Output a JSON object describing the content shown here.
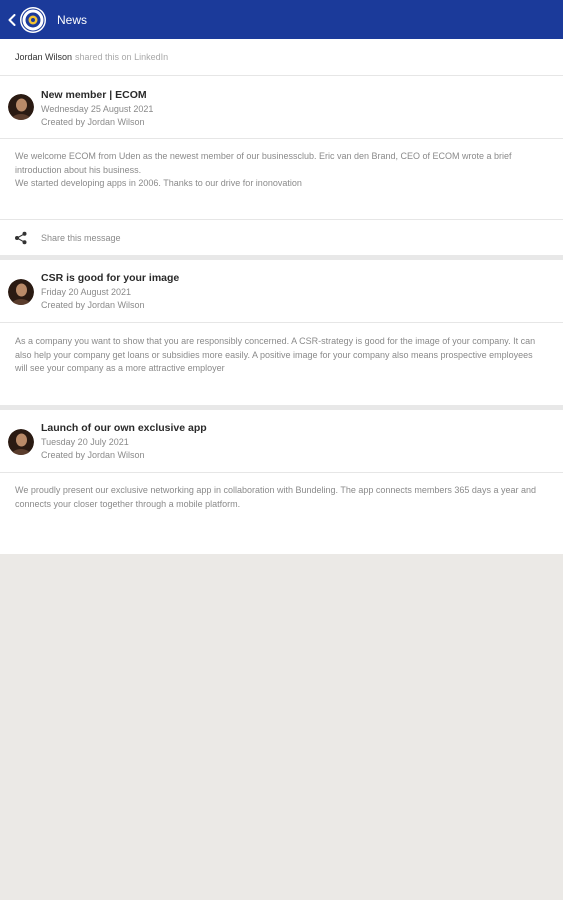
{
  "appbar": {
    "title": "News",
    "back_icon": "chevron-left-icon",
    "logo_icon": "club-logo-icon",
    "background": "#1b3a9a"
  },
  "shared": {
    "name": "Jordan Wilson",
    "rest": "shared this on LinkedIn"
  },
  "posts": [
    {
      "title": "New member | ECOM",
      "date": "Wednesday 25 August 2021",
      "author": "Created by Jordan Wilson",
      "body_lines": [
        "We welcome ECOM from Uden as the newest member of our businessclub. Eric van den Brand, CEO of ECOM wrote a brief introduction about his business.",
        "We started developing apps in 2006. Thanks to our drive for inonovation"
      ],
      "share_label": "Share this message"
    },
    {
      "title": "CSR is good for your image",
      "date": "Friday 20 August 2021",
      "author": "Created by Jordan Wilson",
      "body_lines": [
        "As a company you want to show that you are responsibly concerned. A CSR-strategy is good for the image of your company. It can also help your company get loans or subsidies more easily. A positive image for your company also means prospective employees will see your company as a more attractive employer"
      ]
    },
    {
      "title": "Launch of our own exclusive app",
      "date": "Tuesday 20 July 2021",
      "author": "Created by Jordan Wilson",
      "body_lines": [
        "We proudly present our exclusive networking app in collaboration with Bundeling. The app connects members 365 days a year and connects your closer together through a mobile platform."
      ]
    }
  ]
}
